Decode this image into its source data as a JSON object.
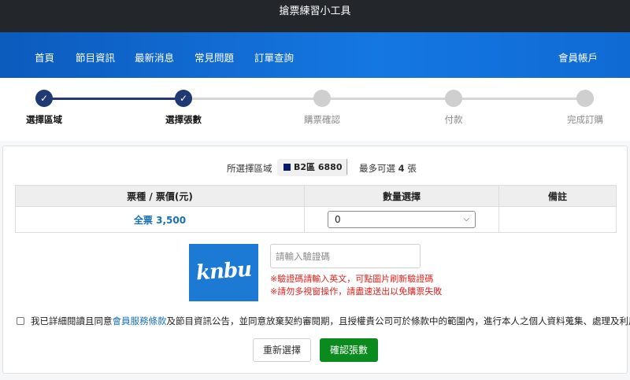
{
  "topbar": {
    "title": "搶票練習小工具"
  },
  "nav": {
    "items": [
      {
        "label": "首頁"
      },
      {
        "label": "節目資訊"
      },
      {
        "label": "最新消息"
      },
      {
        "label": "常見問題"
      },
      {
        "label": "訂單查詢"
      }
    ],
    "account_label": "會員帳戶"
  },
  "stepper": {
    "steps": [
      {
        "label": "選擇區域",
        "status": "done"
      },
      {
        "label": "選擇張數",
        "status": "done"
      },
      {
        "label": "購票確認",
        "status": "todo"
      },
      {
        "label": "付款",
        "status": "todo"
      },
      {
        "label": "完成訂購",
        "status": "todo"
      }
    ],
    "check_glyph": "✓"
  },
  "selection": {
    "label": "所選擇區域",
    "area": "B2區 6880",
    "area_color": "#0a1a6b",
    "max_prefix": "最多可選",
    "max_count": "4",
    "max_suffix": "張"
  },
  "table": {
    "headers": [
      "票種 / 票價(元)",
      "數量選擇",
      "備註"
    ],
    "rows": [
      {
        "ticket": "全票 3,500",
        "quantity": "0",
        "remark": ""
      }
    ]
  },
  "captcha": {
    "image_text": "knbu",
    "placeholder": "請輸入驗證碼",
    "notes": [
      "※驗證碼請輸入英文，可點圖片刷新驗證碼",
      "※請勿多視窗操作，請盡速送出以免購票失敗"
    ]
  },
  "agreement": {
    "prefix": "我已詳細閱讀且同意",
    "link": "會員服務條款",
    "suffix": "及節目資訊公告，並同意放棄契約審閱期，且授權貴公司可於條款中的範圍內，進行本人之個人資料蒐集、處理及利用。"
  },
  "buttons": {
    "reset": "重新選擇",
    "confirm": "確認張數"
  },
  "colors": {
    "nav_blue": "#1577e2",
    "step_done": "#1f3a73",
    "confirm_green": "#0b8a1e",
    "warning_red": "#e0201c",
    "link_blue": "#1a6fb5"
  }
}
